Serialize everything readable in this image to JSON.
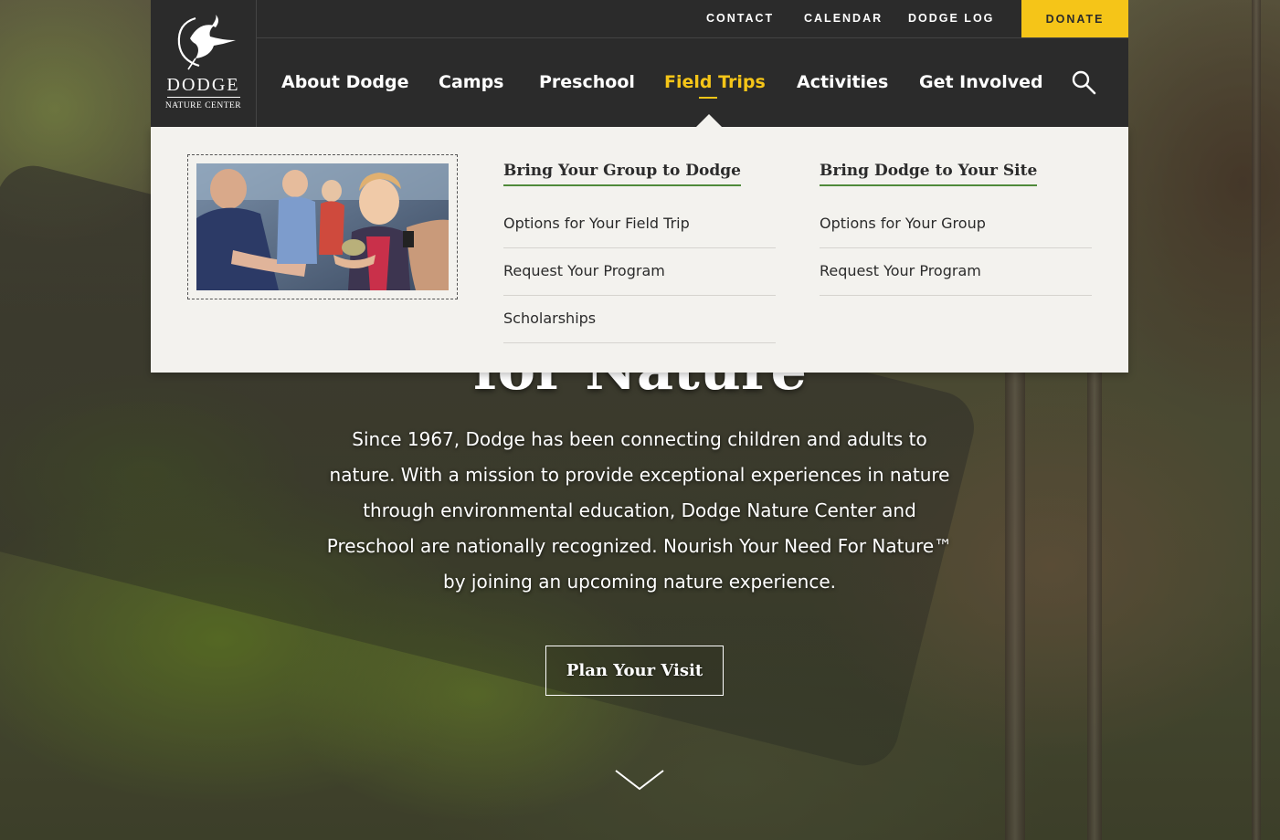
{
  "header": {
    "logo": {
      "name": "DODGE",
      "subtitle": "NATURE CENTER"
    },
    "utility_links": [
      "CONTACT",
      "CALENDAR",
      "DODGE LOG"
    ],
    "donate_label": "DONATE",
    "nav": {
      "items": [
        "About Dodge",
        "Camps",
        "Preschool",
        "Field Trips",
        "Activities",
        "Get Involved"
      ],
      "active": "Field Trips"
    },
    "search_icon": "magnifier"
  },
  "mega_menu": {
    "columns": [
      {
        "title": "Bring Your Group to Dodge",
        "items": [
          "Options for Your Field Trip",
          "Request Your Program",
          "Scholarships"
        ]
      },
      {
        "title": "Bring Dodge to Your Site",
        "items": [
          "Options for Your Group",
          "Request Your Program"
        ]
      }
    ]
  },
  "hero": {
    "title": "for Nature",
    "description": "Since 1967, Dodge has been connecting children and adults to nature. With a mission to provide exceptional experiences in nature through environmental education, Dodge Nature Center and Preschool are nationally recognized. Nourish Your Need For Nature™ by joining an upcoming nature experience.",
    "cta_label": "Plan Your Visit",
    "scroll_icon": "chevron-down"
  },
  "colors": {
    "header_bg": "#2b2b2b",
    "accent_yellow": "#f5c518",
    "menu_bg": "#f3f2ee",
    "title_underline_green": "#4f8a3a"
  }
}
